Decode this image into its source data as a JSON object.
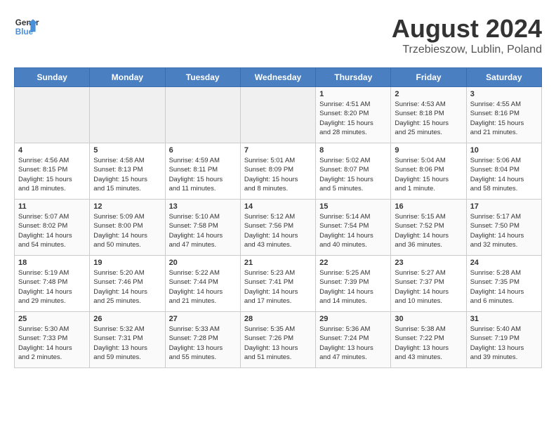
{
  "header": {
    "logo_line1": "General",
    "logo_line2": "Blue",
    "title": "August 2024",
    "subtitle": "Trzebieszow, Lublin, Poland"
  },
  "weekdays": [
    "Sunday",
    "Monday",
    "Tuesday",
    "Wednesday",
    "Thursday",
    "Friday",
    "Saturday"
  ],
  "weeks": [
    [
      {
        "day": "",
        "empty": true
      },
      {
        "day": "",
        "empty": true
      },
      {
        "day": "",
        "empty": true
      },
      {
        "day": "",
        "empty": true
      },
      {
        "day": "1",
        "info": "Sunrise: 4:51 AM\nSunset: 8:20 PM\nDaylight: 15 hours\nand 28 minutes."
      },
      {
        "day": "2",
        "info": "Sunrise: 4:53 AM\nSunset: 8:18 PM\nDaylight: 15 hours\nand 25 minutes."
      },
      {
        "day": "3",
        "info": "Sunrise: 4:55 AM\nSunset: 8:16 PM\nDaylight: 15 hours\nand 21 minutes."
      }
    ],
    [
      {
        "day": "4",
        "info": "Sunrise: 4:56 AM\nSunset: 8:15 PM\nDaylight: 15 hours\nand 18 minutes."
      },
      {
        "day": "5",
        "info": "Sunrise: 4:58 AM\nSunset: 8:13 PM\nDaylight: 15 hours\nand 15 minutes."
      },
      {
        "day": "6",
        "info": "Sunrise: 4:59 AM\nSunset: 8:11 PM\nDaylight: 15 hours\nand 11 minutes."
      },
      {
        "day": "7",
        "info": "Sunrise: 5:01 AM\nSunset: 8:09 PM\nDaylight: 15 hours\nand 8 minutes."
      },
      {
        "day": "8",
        "info": "Sunrise: 5:02 AM\nSunset: 8:07 PM\nDaylight: 15 hours\nand 5 minutes."
      },
      {
        "day": "9",
        "info": "Sunrise: 5:04 AM\nSunset: 8:06 PM\nDaylight: 15 hours\nand 1 minute."
      },
      {
        "day": "10",
        "info": "Sunrise: 5:06 AM\nSunset: 8:04 PM\nDaylight: 14 hours\nand 58 minutes."
      }
    ],
    [
      {
        "day": "11",
        "info": "Sunrise: 5:07 AM\nSunset: 8:02 PM\nDaylight: 14 hours\nand 54 minutes."
      },
      {
        "day": "12",
        "info": "Sunrise: 5:09 AM\nSunset: 8:00 PM\nDaylight: 14 hours\nand 50 minutes."
      },
      {
        "day": "13",
        "info": "Sunrise: 5:10 AM\nSunset: 7:58 PM\nDaylight: 14 hours\nand 47 minutes."
      },
      {
        "day": "14",
        "info": "Sunrise: 5:12 AM\nSunset: 7:56 PM\nDaylight: 14 hours\nand 43 minutes."
      },
      {
        "day": "15",
        "info": "Sunrise: 5:14 AM\nSunset: 7:54 PM\nDaylight: 14 hours\nand 40 minutes."
      },
      {
        "day": "16",
        "info": "Sunrise: 5:15 AM\nSunset: 7:52 PM\nDaylight: 14 hours\nand 36 minutes."
      },
      {
        "day": "17",
        "info": "Sunrise: 5:17 AM\nSunset: 7:50 PM\nDaylight: 14 hours\nand 32 minutes."
      }
    ],
    [
      {
        "day": "18",
        "info": "Sunrise: 5:19 AM\nSunset: 7:48 PM\nDaylight: 14 hours\nand 29 minutes."
      },
      {
        "day": "19",
        "info": "Sunrise: 5:20 AM\nSunset: 7:46 PM\nDaylight: 14 hours\nand 25 minutes."
      },
      {
        "day": "20",
        "info": "Sunrise: 5:22 AM\nSunset: 7:44 PM\nDaylight: 14 hours\nand 21 minutes."
      },
      {
        "day": "21",
        "info": "Sunrise: 5:23 AM\nSunset: 7:41 PM\nDaylight: 14 hours\nand 17 minutes."
      },
      {
        "day": "22",
        "info": "Sunrise: 5:25 AM\nSunset: 7:39 PM\nDaylight: 14 hours\nand 14 minutes."
      },
      {
        "day": "23",
        "info": "Sunrise: 5:27 AM\nSunset: 7:37 PM\nDaylight: 14 hours\nand 10 minutes."
      },
      {
        "day": "24",
        "info": "Sunrise: 5:28 AM\nSunset: 7:35 PM\nDaylight: 14 hours\nand 6 minutes."
      }
    ],
    [
      {
        "day": "25",
        "info": "Sunrise: 5:30 AM\nSunset: 7:33 PM\nDaylight: 14 hours\nand 2 minutes."
      },
      {
        "day": "26",
        "info": "Sunrise: 5:32 AM\nSunset: 7:31 PM\nDaylight: 13 hours\nand 59 minutes."
      },
      {
        "day": "27",
        "info": "Sunrise: 5:33 AM\nSunset: 7:28 PM\nDaylight: 13 hours\nand 55 minutes."
      },
      {
        "day": "28",
        "info": "Sunrise: 5:35 AM\nSunset: 7:26 PM\nDaylight: 13 hours\nand 51 minutes."
      },
      {
        "day": "29",
        "info": "Sunrise: 5:36 AM\nSunset: 7:24 PM\nDaylight: 13 hours\nand 47 minutes."
      },
      {
        "day": "30",
        "info": "Sunrise: 5:38 AM\nSunset: 7:22 PM\nDaylight: 13 hours\nand 43 minutes."
      },
      {
        "day": "31",
        "info": "Sunrise: 5:40 AM\nSunset: 7:19 PM\nDaylight: 13 hours\nand 39 minutes."
      }
    ]
  ]
}
